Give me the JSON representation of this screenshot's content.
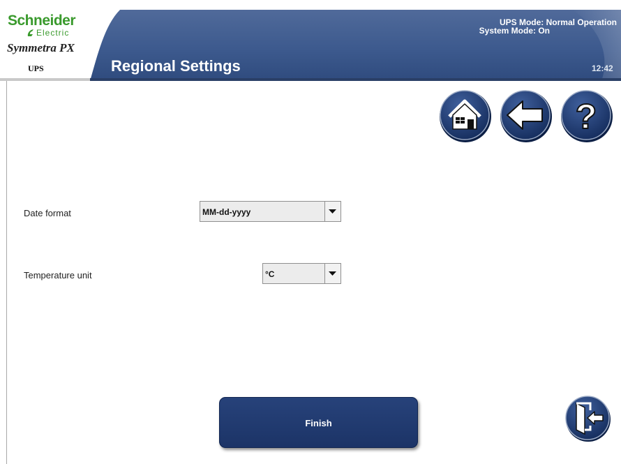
{
  "header": {
    "brand": "Schneider",
    "brand_sub": "Electric",
    "product": "Symmetra PX",
    "product_type": "UPS",
    "title": "Regional Settings",
    "ups_mode": "UPS Mode: Normal Operation",
    "system_mode": "System Mode: On",
    "clock": "12:42"
  },
  "nav": {
    "home_icon": "home-icon",
    "back_icon": "back-arrow-icon",
    "help_icon": "question-mark-icon"
  },
  "form": {
    "date_format_label": "Date format",
    "date_format_value": "MM-dd-yyyy",
    "temperature_unit_label": "Temperature unit",
    "temperature_unit_value": "°C"
  },
  "actions": {
    "finish_label": "Finish",
    "exit_icon": "exit-door-icon"
  },
  "colors": {
    "header_blue": "#3d5a8e",
    "button_navy": "#1f3a6e",
    "brand_green": "#3a9a2d"
  }
}
